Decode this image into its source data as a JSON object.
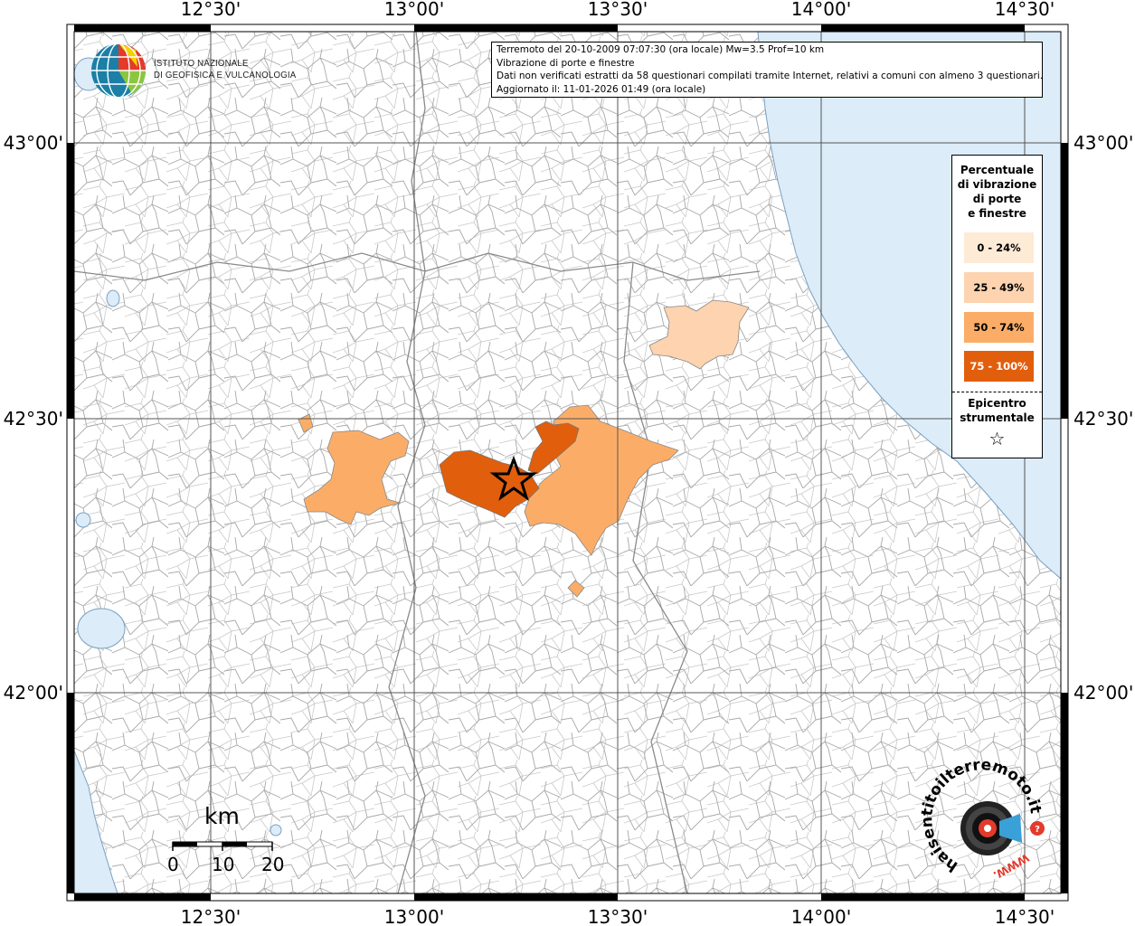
{
  "info": {
    "line1": "Terremoto del 20-10-2009 07:07:30 (ora locale) Mw=3.5 Prof=10 km",
    "line2": "Vibrazione di porte e finestre",
    "line3": "Dati non verificati estratti da 58 questionari compilati tramite Internet, relativi a comuni con almeno 3 questionari.",
    "line4": "Aggiornato il: 11-01-2026 01:49 (ora locale)"
  },
  "logo": {
    "line1": "ISTITUTO NAZIONALE",
    "line2": "DI GEOFISICA E VULCANOLOGIA"
  },
  "legend": {
    "title_lines": [
      "Percentuale",
      "di vibrazione",
      "di porte",
      "e finestre"
    ],
    "classes": [
      {
        "label": "0 - 24%",
        "color": "#fdebd6"
      },
      {
        "label": "25 - 49%",
        "color": "#fdd3b0"
      },
      {
        "label": "50 - 74%",
        "color": "#fbad68"
      },
      {
        "label": "75 - 100%",
        "color": "#e15e0c"
      }
    ],
    "epicenter_lines": [
      "Epicentro",
      "strumentale"
    ],
    "epicenter_symbol": "☆"
  },
  "axes": {
    "lon_labels": [
      "12°30'",
      "13°00'",
      "13°30'",
      "14°00'",
      "14°30'"
    ],
    "lat_labels": [
      "43°00'",
      "42°30'",
      "42°00'"
    ]
  },
  "scale_bar": {
    "unit": "km",
    "ticks": [
      "0",
      "10",
      "20"
    ]
  },
  "badge": {
    "text_main": "haisentitoilterremoto.it",
    "text_www": "WWW."
  },
  "colors": {
    "sea": "#dcecf8",
    "border": "#a0a0a0",
    "grid": "#555555",
    "class_50_74": "#fbad68",
    "class_75_100": "#e15e0c",
    "class_25_49": "#fdd3b0"
  }
}
